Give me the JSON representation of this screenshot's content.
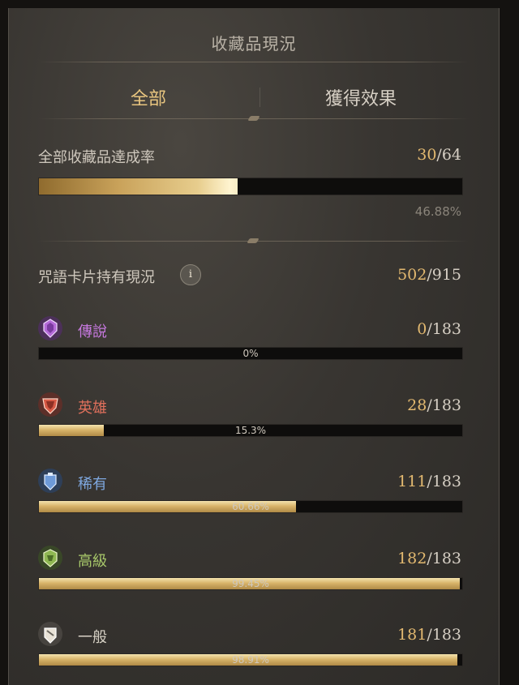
{
  "title": "收藏品現況",
  "tabs": [
    {
      "label": "全部",
      "active": true
    },
    {
      "label": "獲得效果",
      "active": false
    }
  ],
  "overall": {
    "label": "全部收藏品達成率",
    "current": "30",
    "total": "/64",
    "percent_text": "46.88%",
    "fill": 0.4688
  },
  "cards": {
    "label": "咒語卡片持有現況",
    "info_symbol": "i",
    "current": "502",
    "total": "/915"
  },
  "rarities": [
    {
      "label": "傳說",
      "current": "0",
      "total": "/183",
      "percent_text": "0%",
      "fill": 0.0,
      "color": "#c779e0",
      "icon": "legendary-crest-icon"
    },
    {
      "label": "英雄",
      "current": "28",
      "total": "/183",
      "percent_text": "15.3%",
      "fill": 0.153,
      "color": "#e0705c",
      "icon": "heroic-crest-icon"
    },
    {
      "label": "稀有",
      "current": "111",
      "total": "/183",
      "percent_text": "60.66%",
      "fill": 0.6066,
      "color": "#7fa8e0",
      "icon": "rare-crest-icon"
    },
    {
      "label": "高級",
      "current": "182",
      "total": "/183",
      "percent_text": "99.45%",
      "fill": 0.9945,
      "color": "#a8c86a",
      "icon": "advanced-crest-icon"
    },
    {
      "label": "一般",
      "current": "181",
      "total": "/183",
      "percent_text": "98.91%",
      "fill": 0.9891,
      "color": "#d8d2c6",
      "icon": "common-crest-icon"
    }
  ]
}
